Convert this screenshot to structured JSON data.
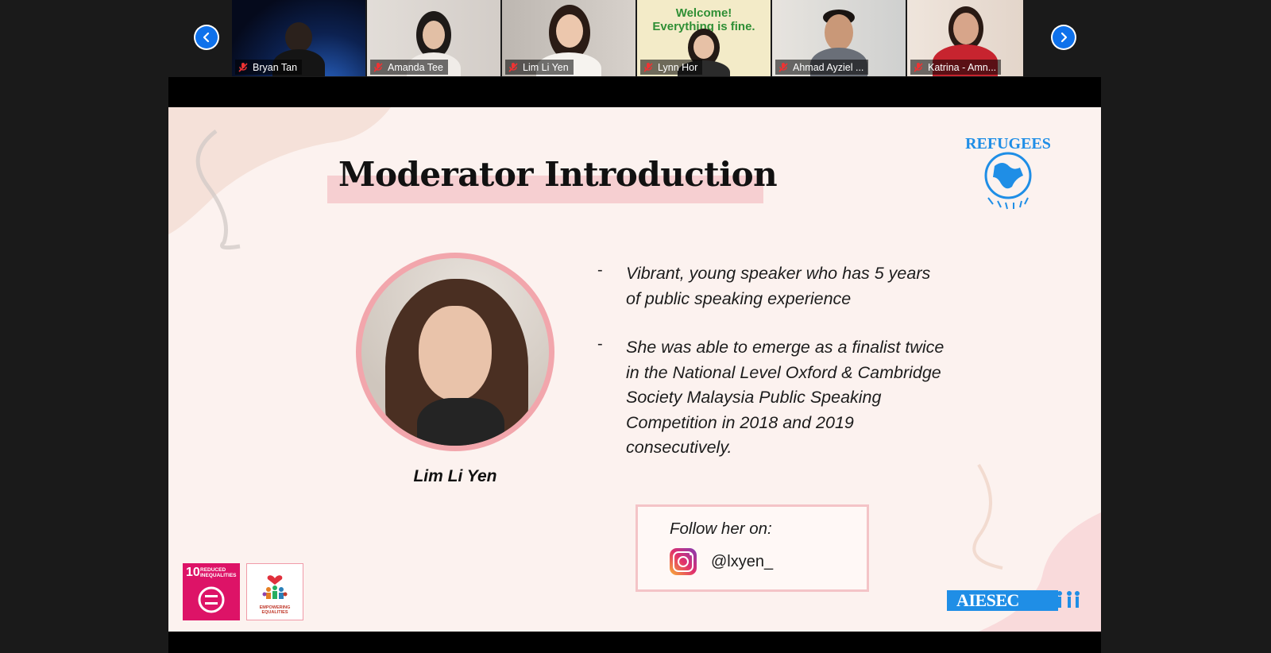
{
  "participants": [
    {
      "name": "Bryan Tan",
      "bg": "#0b1730",
      "muted": true
    },
    {
      "name": "Amanda Tee",
      "bg": "#d9d4cf",
      "muted": true
    },
    {
      "name": "Lim Li Yen",
      "bg": "#c8c2bc",
      "muted": true
    },
    {
      "name": "Lynn Hor",
      "bg": "#f2e9c4",
      "muted": true,
      "banner": "Welcome!\nEverything is fine."
    },
    {
      "name": "Ahmad Ayziel ...",
      "bg": "#d8d6d2",
      "muted": true
    },
    {
      "name": "Katrina - Amn...",
      "bg": "#e8dcd3",
      "muted": true
    }
  ],
  "nav": {
    "prev_icon": "chevron-left-icon",
    "next_icon": "chevron-right-icon",
    "accent": "#0e71eb"
  },
  "slide": {
    "title": "Moderator Introduction",
    "moderator_name": "Lim Li Yen",
    "bullets": [
      "Vibrant, young speaker who has 5 years of public speaking experience",
      "She was able to emerge as a finalist twice in the National Level Oxford & Cambridge Society Malaysia Public Speaking Competition in 2018 and 2019 consecutively."
    ],
    "bullet_marker": "-",
    "follow_label": "Follow her on:",
    "instagram_handle": "@lxyen_",
    "logos": {
      "refugees": "REFUGEES",
      "aiesec": "AIESEC",
      "sdg_number": "10",
      "sdg_label": "REDUCED INEQUALITIES",
      "equality_label": "EMPOWERING EQUALITIES"
    },
    "colors": {
      "background": "#fcf2ef",
      "highlight": "#f6cfd1",
      "ring": "#f2a6ac",
      "sdg": "#dd1367",
      "aiesec": "#1f8ee6"
    }
  }
}
